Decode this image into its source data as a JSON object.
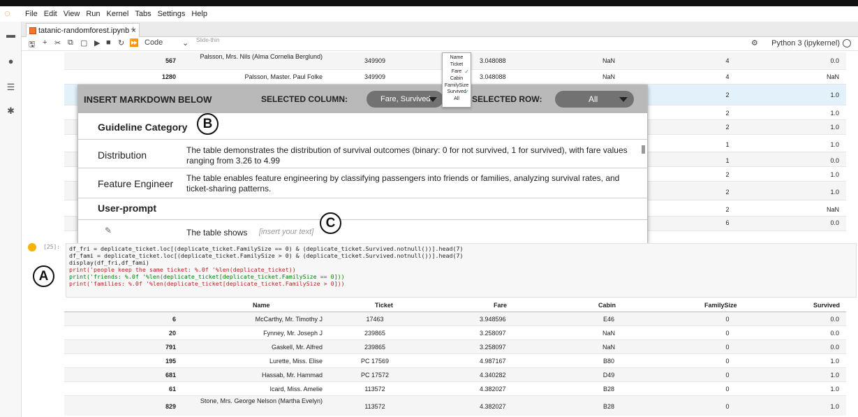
{
  "menubar": {
    "items": [
      "File",
      "Edit",
      "View",
      "Run",
      "Kernel",
      "Tabs",
      "Settings",
      "Help"
    ]
  },
  "tab": {
    "title": "tatanic-randomforest.ipynb",
    "close": "×",
    "new": "+"
  },
  "toolbar": {
    "cell_type": "Code",
    "partial": "Slide-thin",
    "kernel": "Python 3 (ipykernel)"
  },
  "upper_rows": [
    {
      "idx": "567",
      "name": "Palsson, Mrs. Nils (Alma Cornelia Berglund)",
      "ticket": "349909",
      "fare": "3.048088",
      "cabin": "NaN",
      "fsz": "4",
      "surv": "0.0"
    },
    {
      "idx": "1280",
      "name": "Palsson, Master. Paul Folke",
      "ticket": "349909",
      "fare": "3.048088",
      "cabin": "NaN",
      "fsz": "4",
      "surv": "NaN"
    }
  ],
  "upper_right": [
    {
      "fsz": "2",
      "surv": "1.0"
    },
    {
      "fsz": "2",
      "surv": "1.0"
    },
    {
      "fsz": "2",
      "surv": "1.0"
    },
    {
      "fsz": "1",
      "surv": "1.0"
    },
    {
      "fsz": "1",
      "surv": "0.0"
    },
    {
      "fsz": "2",
      "surv": "1.0"
    },
    {
      "fsz": "2",
      "surv": "1.0"
    },
    {
      "fsz": "2",
      "surv": "NaN"
    },
    {
      "fsz": "6",
      "surv": "0.0"
    }
  ],
  "overlay": {
    "insert_label": "INSERT MARKDOWN BELOW",
    "col_label": "SELECTED COLUMN:",
    "col_value": "Fare, Survived",
    "row_label": "SELECTED ROW:",
    "row_value": "All",
    "guideline_header": "Guideline Category",
    "rows": [
      {
        "cat": "Distribution",
        "text": "The table demonstrates the distribution of survival outcomes (binary: 0 for not survived, 1 for survived), with fare values ranging from 3.26 to 4.99"
      },
      {
        "cat": "Feature Engineer",
        "text": "The table enables feature engineering by classifying passengers into friends or families, analyzing survival rates, and ticket-sharing patterns."
      }
    ],
    "user_prompt_label": "User-prompt",
    "prompt_prefix": "The table shows",
    "prompt_placeholder": "[insert your text]"
  },
  "column_menu": [
    "Name",
    "Ticket",
    "Fare",
    "Cabin",
    "FamilySize",
    "Survived",
    "All"
  ],
  "badges": {
    "a": "A",
    "b": "B",
    "c": "C"
  },
  "code": {
    "prompt": "[25]:",
    "lines": [
      "df_fri = deplicate_ticket.loc[(deplicate_ticket.FamilySize == 0) & (deplicate_ticket.Survived.notnull())].head(7)",
      "df_fami = deplicate_ticket.loc[(deplicate_ticket.FamilySize > 0) & (deplicate_ticket.Survived.notnull())].head(7)",
      "display(df_fri,df_fami)",
      "print('people keep the same ticket: %.0f '%len(deplicate_ticket))",
      "print('friends: %.0f '%len(deplicate_ticket[deplicate_ticket.FamilySize == 0]))",
      "print('families: %.0f '%len(deplicate_ticket[deplicate_ticket.FamilySize > 0]))"
    ]
  },
  "table": {
    "headers": [
      "Name",
      "Ticket",
      "Fare",
      "Cabin",
      "FamilySize",
      "Survived"
    ],
    "rows": [
      {
        "idx": "6",
        "name": "McCarthy, Mr. Timothy J",
        "ticket": "17463",
        "fare": "3.948596",
        "cabin": "E46",
        "fsz": "0",
        "surv": "0.0"
      },
      {
        "idx": "20",
        "name": "Fynney, Mr. Joseph J",
        "ticket": "239865",
        "fare": "3.258097",
        "cabin": "NaN",
        "fsz": "0",
        "surv": "0.0"
      },
      {
        "idx": "791",
        "name": "Gaskell, Mr. Alfred",
        "ticket": "239865",
        "fare": "3.258097",
        "cabin": "NaN",
        "fsz": "0",
        "surv": "0.0"
      },
      {
        "idx": "195",
        "name": "Lurette, Miss. Elise",
        "ticket": "PC 17569",
        "fare": "4.987167",
        "cabin": "B80",
        "fsz": "0",
        "surv": "1.0"
      },
      {
        "idx": "681",
        "name": "Hassab, Mr. Hammad",
        "ticket": "PC 17572",
        "fare": "4.340282",
        "cabin": "D49",
        "fsz": "0",
        "surv": "1.0"
      },
      {
        "idx": "61",
        "name": "Icard, Miss. Amelie",
        "ticket": "113572",
        "fare": "4.382027",
        "cabin": "B28",
        "fsz": "0",
        "surv": "1.0"
      },
      {
        "idx": "829",
        "name": "Stone, Mrs. George Nelson (Martha Evelyn)",
        "ticket": "113572",
        "fare": "4.382027",
        "cabin": "B28",
        "fsz": "0",
        "surv": "1.0"
      }
    ]
  }
}
